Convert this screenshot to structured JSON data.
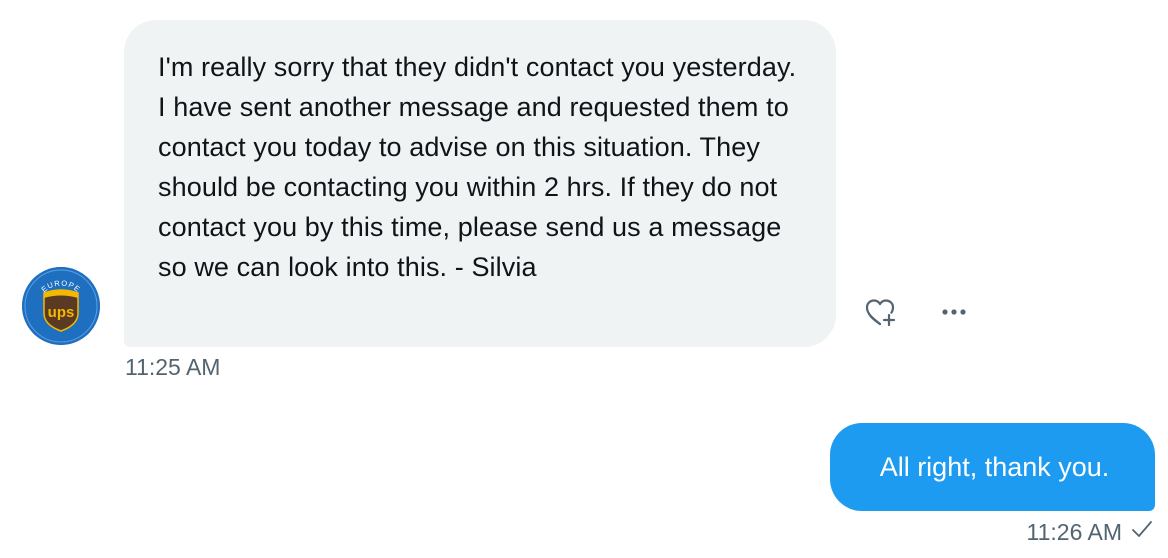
{
  "conversation": {
    "incoming": {
      "sender_badge_text": "EUROPE",
      "sender_logo_text": "ups",
      "text": "I'm really sorry that they didn't contact you yesterday. I have sent another message and requested them to contact you today to advise on this situation. They should be contacting you within 2 hrs. If they do not contact you by this time, please send us a message so we can look into this. - Silvia",
      "time": "11:25 AM",
      "actions": [
        "heart-plus-icon",
        "more-icon"
      ]
    },
    "outgoing": {
      "text": "All right, thank you.",
      "time": "11:26 AM",
      "status_icon": "check-icon"
    }
  },
  "colors": {
    "incoming_bubble": "#eff3f4",
    "outgoing_bubble": "#1d9bf0",
    "meta_text": "#536471",
    "ups_brown": "#5a3a22",
    "ups_gold": "#f5b800"
  }
}
